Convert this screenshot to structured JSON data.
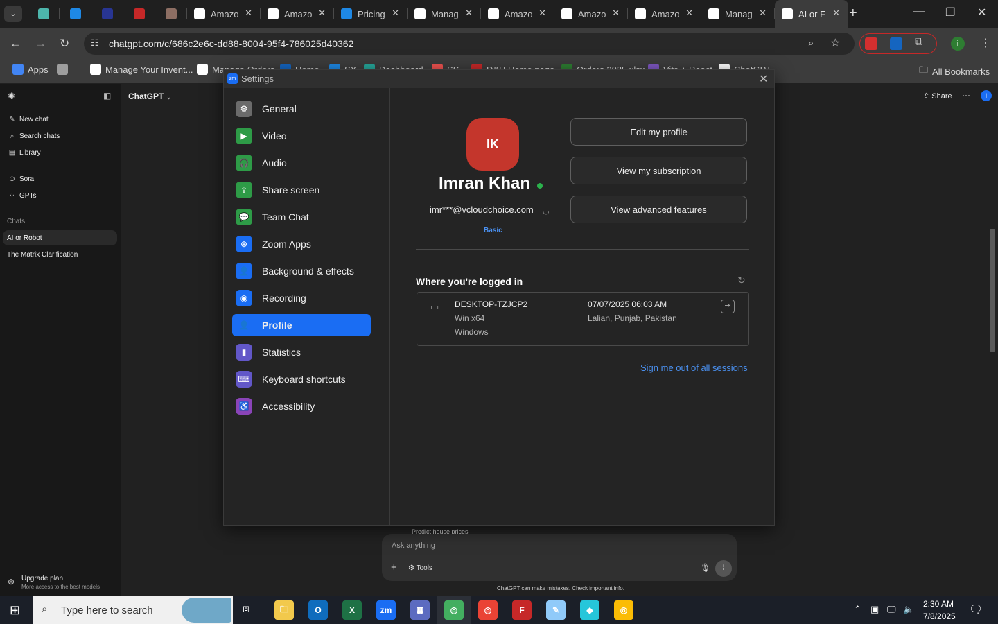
{
  "browser": {
    "tabs": [
      {
        "title": "",
        "icon": "cube-icon",
        "color": "#4db6ac"
      },
      {
        "title": "",
        "icon": "ec-icon",
        "color": "#1e88e5"
      },
      {
        "title": "",
        "icon": "tau-icon",
        "color": "#283593"
      },
      {
        "title": "",
        "icon": "d-h-icon",
        "color": "#c62828"
      },
      {
        "title": "",
        "icon": "stack-icon",
        "color": "#8d6e63"
      },
      {
        "title": "Amazo",
        "icon": "amazon-icon",
        "color": "#ffffff"
      },
      {
        "title": "Amazo",
        "icon": "amazon-icon",
        "color": "#ffffff"
      },
      {
        "title": "Pricing",
        "icon": "dollar-icon",
        "color": "#1e88e5"
      },
      {
        "title": "Manag",
        "icon": "amazon-icon",
        "color": "#ffffff"
      },
      {
        "title": "Amazo",
        "icon": "amazon-icon",
        "color": "#ffffff"
      },
      {
        "title": "Amazo",
        "icon": "amazon-icon",
        "color": "#ffffff"
      },
      {
        "title": "Amazo",
        "icon": "amazon-icon",
        "color": "#ffffff"
      },
      {
        "title": "Manag",
        "icon": "amazon-icon",
        "color": "#ffffff"
      },
      {
        "title": "AI or F",
        "icon": "openai-icon",
        "color": "#ffffff",
        "active": true
      }
    ],
    "url": "chatgpt.com/c/686c2e6c-dd88-8004-95f4-786025d40362",
    "bookmarks": [
      {
        "label": "Apps",
        "color": "#4285f4"
      },
      {
        "label": "",
        "color": "#9e9e9e"
      },
      {
        "label": "Manage Your Invent...",
        "color": "#ffffff"
      },
      {
        "label": "Manage Orders",
        "color": "#ffffff"
      },
      {
        "label": "Home",
        "color": "#1565c0"
      },
      {
        "label": "SX",
        "color": "#1e88e5"
      },
      {
        "label": "Dashboard",
        "color": "#26a69a"
      },
      {
        "label": "SS",
        "color": "#ef5350"
      },
      {
        "label": "D&H Home page",
        "color": "#c62828"
      },
      {
        "label": "Orders 2025.xlsx",
        "color": "#2e7d32"
      },
      {
        "label": "Vite + React",
        "color": "#7e57c2"
      },
      {
        "label": "ChatGPT",
        "color": "#ffffff"
      }
    ],
    "all_bookmarks": "All Bookmarks",
    "profile_initial": "i"
  },
  "chatgpt": {
    "model": "ChatGPT",
    "share": "Share",
    "sidebar": {
      "items": [
        {
          "label": "New chat",
          "icon": "pencil-icon"
        },
        {
          "label": "Search chats",
          "icon": "search-icon"
        },
        {
          "label": "Library",
          "icon": "library-icon"
        },
        {
          "label": "Sora",
          "icon": "play-icon"
        },
        {
          "label": "GPTs",
          "icon": "grid-icon"
        }
      ],
      "section": "Chats",
      "chats": [
        "AI or Robot",
        "The Matrix Clarification"
      ],
      "upgrade_title": "Upgrade plan",
      "upgrade_sub": "More access to the best models"
    },
    "composer": {
      "peek": "Predict house prices",
      "placeholder": "Ask anything",
      "tools": "Tools",
      "disclaimer": "ChatGPT can make mistakes. Check important info."
    }
  },
  "zoom": {
    "title": "Settings",
    "logo": "zm",
    "nav": [
      {
        "label": "General",
        "icon": "gear-icon",
        "color": "#6b6b6b"
      },
      {
        "label": "Video",
        "icon": "video-icon",
        "color": "#2e9b47"
      },
      {
        "label": "Audio",
        "icon": "headphones-icon",
        "color": "#2e9b47"
      },
      {
        "label": "Share screen",
        "icon": "share-screen-icon",
        "color": "#2e9b47"
      },
      {
        "label": "Team Chat",
        "icon": "chat-icon",
        "color": "#2e9b47"
      },
      {
        "label": "Zoom Apps",
        "icon": "apps-icon",
        "color": "#1a6df3"
      },
      {
        "label": "Background & effects",
        "icon": "person-icon",
        "color": "#1a6df3"
      },
      {
        "label": "Recording",
        "icon": "record-icon",
        "color": "#1a6df3"
      },
      {
        "label": "Profile",
        "icon": "profile-icon",
        "color": "#1a6df3",
        "selected": true
      },
      {
        "label": "Statistics",
        "icon": "bar-chart-icon",
        "color": "#6257c8"
      },
      {
        "label": "Keyboard shortcuts",
        "icon": "keyboard-icon",
        "color": "#6257c8"
      },
      {
        "label": "Accessibility",
        "icon": "accessibility-icon",
        "color": "#8a44b8"
      }
    ],
    "profile": {
      "initials": "IK",
      "avatar_color": "#c4362c",
      "name": "Imran Khan",
      "status_color": "#2bb24c",
      "email": "imr***@vcloudchoice.com",
      "plan": "Basic",
      "buttons": [
        "Edit my profile",
        "View my subscription",
        "View advanced features"
      ]
    },
    "sessions": {
      "title": "Where you're logged in",
      "device": "DESKTOP-TZJCP2",
      "os": "Win x64",
      "platform": "Windows",
      "datetime": "07/07/2025 06:03 AM",
      "location": "Lalian, Punjab, Pakistan",
      "signout_all": "Sign me out of all sessions"
    }
  },
  "taskbar": {
    "search_placeholder": "Type here to search",
    "time": "2:30 AM",
    "date": "7/8/2025"
  }
}
